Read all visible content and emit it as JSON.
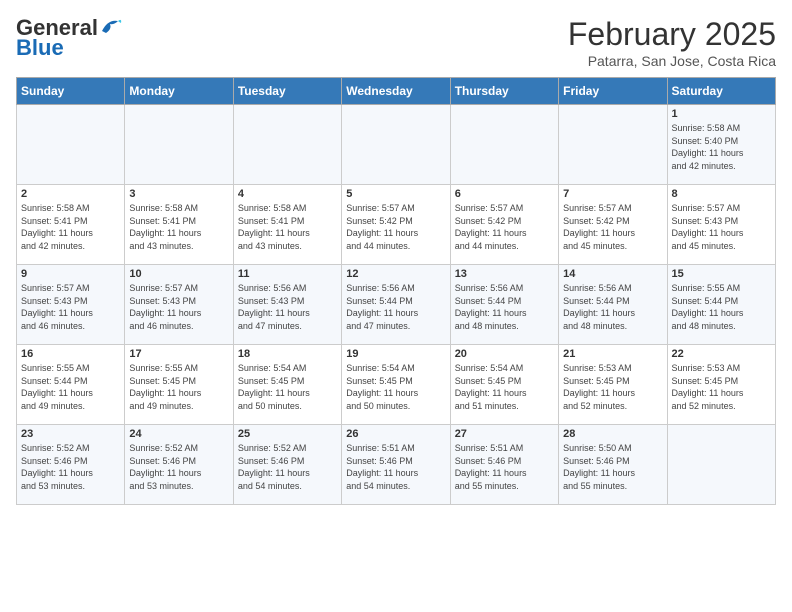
{
  "header": {
    "logo_general": "General",
    "logo_blue": "Blue",
    "month_title": "February 2025",
    "subtitle": "Patarra, San Jose, Costa Rica"
  },
  "days_of_week": [
    "Sunday",
    "Monday",
    "Tuesday",
    "Wednesday",
    "Thursday",
    "Friday",
    "Saturday"
  ],
  "weeks": [
    [
      {
        "day": "",
        "info": ""
      },
      {
        "day": "",
        "info": ""
      },
      {
        "day": "",
        "info": ""
      },
      {
        "day": "",
        "info": ""
      },
      {
        "day": "",
        "info": ""
      },
      {
        "day": "",
        "info": ""
      },
      {
        "day": "1",
        "info": "Sunrise: 5:58 AM\nSunset: 5:40 PM\nDaylight: 11 hours\nand 42 minutes."
      }
    ],
    [
      {
        "day": "2",
        "info": "Sunrise: 5:58 AM\nSunset: 5:41 PM\nDaylight: 11 hours\nand 42 minutes."
      },
      {
        "day": "3",
        "info": "Sunrise: 5:58 AM\nSunset: 5:41 PM\nDaylight: 11 hours\nand 43 minutes."
      },
      {
        "day": "4",
        "info": "Sunrise: 5:58 AM\nSunset: 5:41 PM\nDaylight: 11 hours\nand 43 minutes."
      },
      {
        "day": "5",
        "info": "Sunrise: 5:57 AM\nSunset: 5:42 PM\nDaylight: 11 hours\nand 44 minutes."
      },
      {
        "day": "6",
        "info": "Sunrise: 5:57 AM\nSunset: 5:42 PM\nDaylight: 11 hours\nand 44 minutes."
      },
      {
        "day": "7",
        "info": "Sunrise: 5:57 AM\nSunset: 5:42 PM\nDaylight: 11 hours\nand 45 minutes."
      },
      {
        "day": "8",
        "info": "Sunrise: 5:57 AM\nSunset: 5:43 PM\nDaylight: 11 hours\nand 45 minutes."
      }
    ],
    [
      {
        "day": "9",
        "info": "Sunrise: 5:57 AM\nSunset: 5:43 PM\nDaylight: 11 hours\nand 46 minutes."
      },
      {
        "day": "10",
        "info": "Sunrise: 5:57 AM\nSunset: 5:43 PM\nDaylight: 11 hours\nand 46 minutes."
      },
      {
        "day": "11",
        "info": "Sunrise: 5:56 AM\nSunset: 5:43 PM\nDaylight: 11 hours\nand 47 minutes."
      },
      {
        "day": "12",
        "info": "Sunrise: 5:56 AM\nSunset: 5:44 PM\nDaylight: 11 hours\nand 47 minutes."
      },
      {
        "day": "13",
        "info": "Sunrise: 5:56 AM\nSunset: 5:44 PM\nDaylight: 11 hours\nand 48 minutes."
      },
      {
        "day": "14",
        "info": "Sunrise: 5:56 AM\nSunset: 5:44 PM\nDaylight: 11 hours\nand 48 minutes."
      },
      {
        "day": "15",
        "info": "Sunrise: 5:55 AM\nSunset: 5:44 PM\nDaylight: 11 hours\nand 48 minutes."
      }
    ],
    [
      {
        "day": "16",
        "info": "Sunrise: 5:55 AM\nSunset: 5:44 PM\nDaylight: 11 hours\nand 49 minutes."
      },
      {
        "day": "17",
        "info": "Sunrise: 5:55 AM\nSunset: 5:45 PM\nDaylight: 11 hours\nand 49 minutes."
      },
      {
        "day": "18",
        "info": "Sunrise: 5:54 AM\nSunset: 5:45 PM\nDaylight: 11 hours\nand 50 minutes."
      },
      {
        "day": "19",
        "info": "Sunrise: 5:54 AM\nSunset: 5:45 PM\nDaylight: 11 hours\nand 50 minutes."
      },
      {
        "day": "20",
        "info": "Sunrise: 5:54 AM\nSunset: 5:45 PM\nDaylight: 11 hours\nand 51 minutes."
      },
      {
        "day": "21",
        "info": "Sunrise: 5:53 AM\nSunset: 5:45 PM\nDaylight: 11 hours\nand 52 minutes."
      },
      {
        "day": "22",
        "info": "Sunrise: 5:53 AM\nSunset: 5:45 PM\nDaylight: 11 hours\nand 52 minutes."
      }
    ],
    [
      {
        "day": "23",
        "info": "Sunrise: 5:52 AM\nSunset: 5:46 PM\nDaylight: 11 hours\nand 53 minutes."
      },
      {
        "day": "24",
        "info": "Sunrise: 5:52 AM\nSunset: 5:46 PM\nDaylight: 11 hours\nand 53 minutes."
      },
      {
        "day": "25",
        "info": "Sunrise: 5:52 AM\nSunset: 5:46 PM\nDaylight: 11 hours\nand 54 minutes."
      },
      {
        "day": "26",
        "info": "Sunrise: 5:51 AM\nSunset: 5:46 PM\nDaylight: 11 hours\nand 54 minutes."
      },
      {
        "day": "27",
        "info": "Sunrise: 5:51 AM\nSunset: 5:46 PM\nDaylight: 11 hours\nand 55 minutes."
      },
      {
        "day": "28",
        "info": "Sunrise: 5:50 AM\nSunset: 5:46 PM\nDaylight: 11 hours\nand 55 minutes."
      },
      {
        "day": "",
        "info": ""
      }
    ]
  ]
}
